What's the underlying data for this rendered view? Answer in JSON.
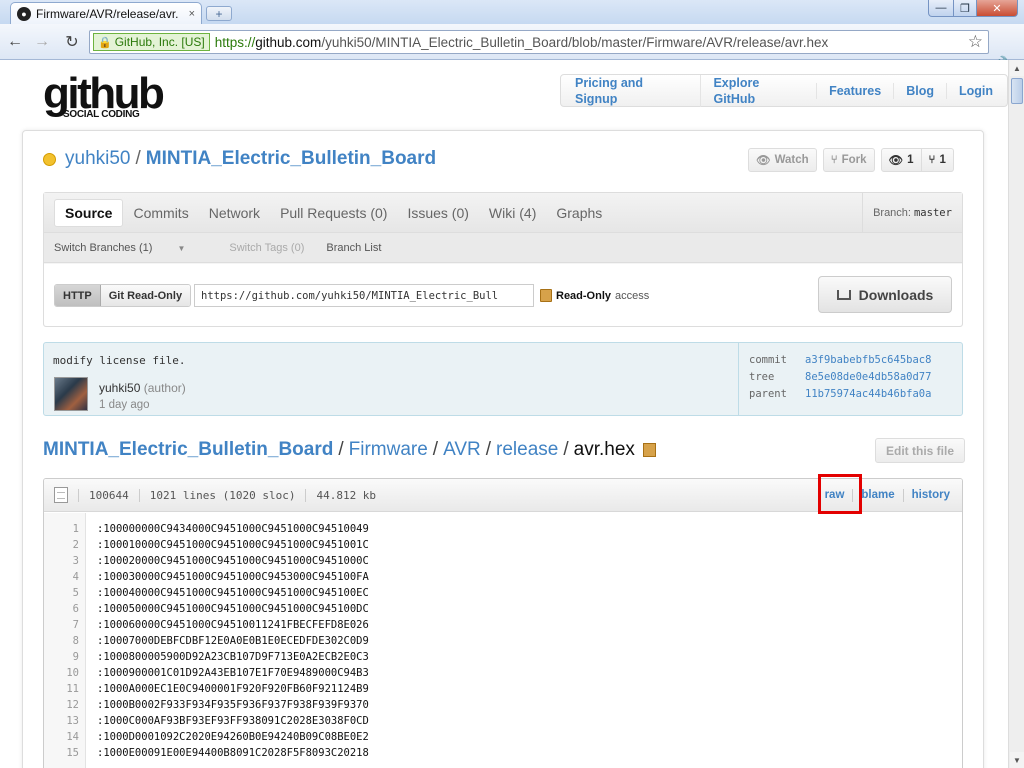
{
  "browser": {
    "tab_title": "Firmware/AVR/release/avr.",
    "tab_close": "×",
    "new_tab": "+",
    "ssl_label": "GitHub, Inc. [US]",
    "url_scheme": "https://",
    "url_host": "github.com",
    "url_path": "/yuhki50/MINTIA_Electric_Bulletin_Board/blob/master/Firmware/AVR/release/avr.hex",
    "back_icon": "←",
    "forward_icon": "→",
    "reload_icon": "↻",
    "star_icon": "☆",
    "wrench_icon": "🔧",
    "min_icon": "—",
    "max_icon": "❐",
    "close_icon": "✕"
  },
  "header": {
    "logo_main": "github",
    "logo_sub": "SOCIAL CODING",
    "nav": [
      "Pricing and Signup",
      "Explore GitHub",
      "Features",
      "Blog",
      "Login"
    ]
  },
  "repo": {
    "owner": "yuhki50",
    "separator": "/",
    "name": "MINTIA_Electric_Bulletin_Board",
    "watch_label": "Watch",
    "fork_label": "Fork",
    "watchers": "1",
    "forks": "1"
  },
  "tabs": {
    "items": [
      "Source",
      "Commits",
      "Network",
      "Pull Requests (0)",
      "Issues (0)",
      "Wiki (4)",
      "Graphs"
    ],
    "branch_label": "Branch:",
    "branch_value": "master"
  },
  "subnav": {
    "switch_branches": "Switch Branches (1)",
    "switch_tags": "Switch Tags (0)",
    "branch_list": "Branch List"
  },
  "clone": {
    "http": "HTTP",
    "git_ro": "Git Read-Only",
    "url": "https://github.com/yuhki50/MINTIA_Electric_Bull",
    "access_bold": "Read-Only",
    "access_rest": "access",
    "downloads": "Downloads"
  },
  "commit": {
    "message": "modify license file.",
    "author": "yuhki50",
    "role": "(author)",
    "date": "1 day ago",
    "commit_label": "commit",
    "commit_sha": "a3f9babebfb5c645bac8",
    "tree_label": "tree",
    "tree_sha": "8e5e08de0e4db58a0d77",
    "parent_label": "parent",
    "parent_sha": "11b75974ac44b46bfa0a"
  },
  "breadcrumb": {
    "repo": "MINTIA_Electric_Bulletin_Board",
    "sep": "/",
    "p1": "Firmware",
    "p2": "AVR",
    "p3": "release",
    "file": "avr.hex",
    "edit_button": "Edit this file"
  },
  "file": {
    "mode": "100644",
    "lines": "1021 lines (1020 sloc)",
    "size": "44.812 kb",
    "raw": "raw",
    "blame": "blame",
    "history": "history",
    "code": [
      ":100000000C9434000C9451000C9451000C94510049",
      ":100010000C9451000C9451000C9451000C9451001C",
      ":100020000C9451000C9451000C9451000C9451000C",
      ":100030000C9451000C9451000C9453000C945100FA",
      ":100040000C9451000C9451000C9451000C945100EC",
      ":100050000C9451000C9451000C9451000C945100DC",
      ":100060000C9451000C94510011241FBECFEFD8E026",
      ":10007000DEBFCDBF12E0A0E0B1E0ECEDFDE302C0D9",
      ":1000800005900D92A23CB107D9F713E0A2ECB2E0C3",
      ":1000900001C01D92A43EB107E1F70E9489000C94B3",
      ":1000A000EC1E0C9400001F920F920FB60F921124B9",
      ":1000B0002F933F934F935F936F937F938F939F9370",
      ":1000C000AF93BF93EF93FF938091C2028E3038F0CD",
      ":1000D0001092C2020E94260B0E94240B09C08BE0E2",
      ":1000E00091E00E94400B8091C2028F5F8093C20218"
    ]
  }
}
